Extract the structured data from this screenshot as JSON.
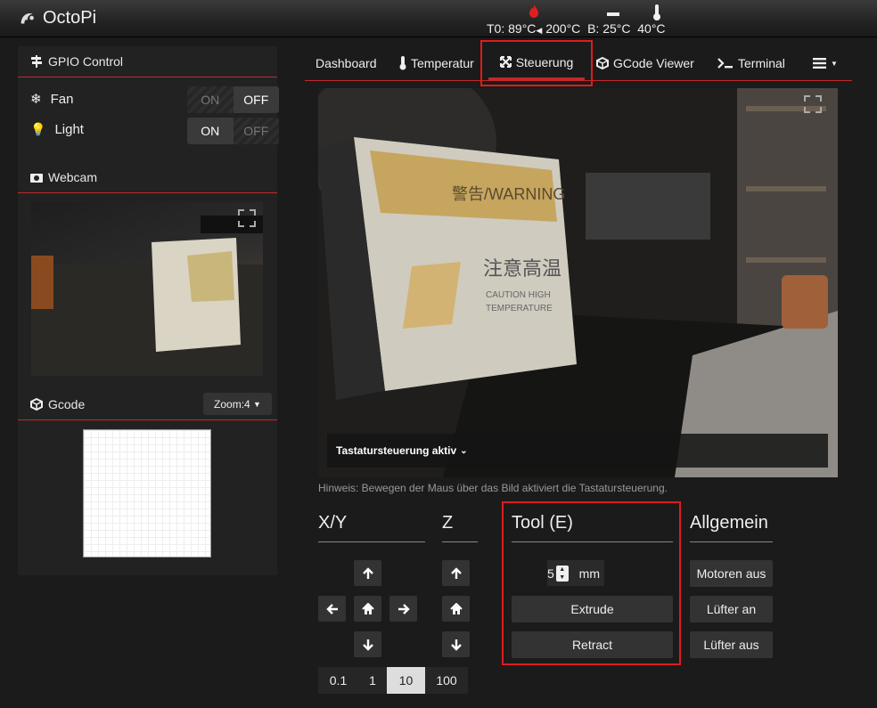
{
  "app": {
    "title": "OctoPi"
  },
  "temps": {
    "tool0": "T0: 89°C",
    "tool0_target": "200°C",
    "bed": "B: 25°C",
    "chamber": "40°C"
  },
  "sidebar": {
    "gpio": {
      "title": "GPIO Control",
      "items": [
        {
          "label": "Fan",
          "on": "ON",
          "off": "OFF",
          "state": "off"
        },
        {
          "label": "Light",
          "on": "ON",
          "off": "OFF",
          "state": "on"
        }
      ]
    },
    "webcam": {
      "title": "Webcam"
    },
    "gcode": {
      "title": "Gcode",
      "zoom": "Zoom:4"
    }
  },
  "tabs": [
    {
      "label": "Dashboard"
    },
    {
      "label": "Temperatur"
    },
    {
      "label": "Steuerung",
      "active": true
    },
    {
      "label": "GCode Viewer"
    },
    {
      "label": "Terminal"
    }
  ],
  "control": {
    "keyboard_label": "Tastatursteuerung aktiv",
    "hint": "Hinweis: Bewegen der Maus über das Bild aktiviert die Tastatursteuerung.",
    "xy": "X/Y",
    "z": "Z",
    "tool": "Tool (E)",
    "general": "Allgemein",
    "amount": "5",
    "unit": "mm",
    "extrude": "Extrude",
    "retract": "Retract",
    "motors_off": "Motoren aus",
    "fan_on": "Lüfter an",
    "fan_off": "Lüfter aus",
    "steps": [
      "0.1",
      "1",
      "10",
      "100"
    ],
    "selected_step": "10"
  }
}
